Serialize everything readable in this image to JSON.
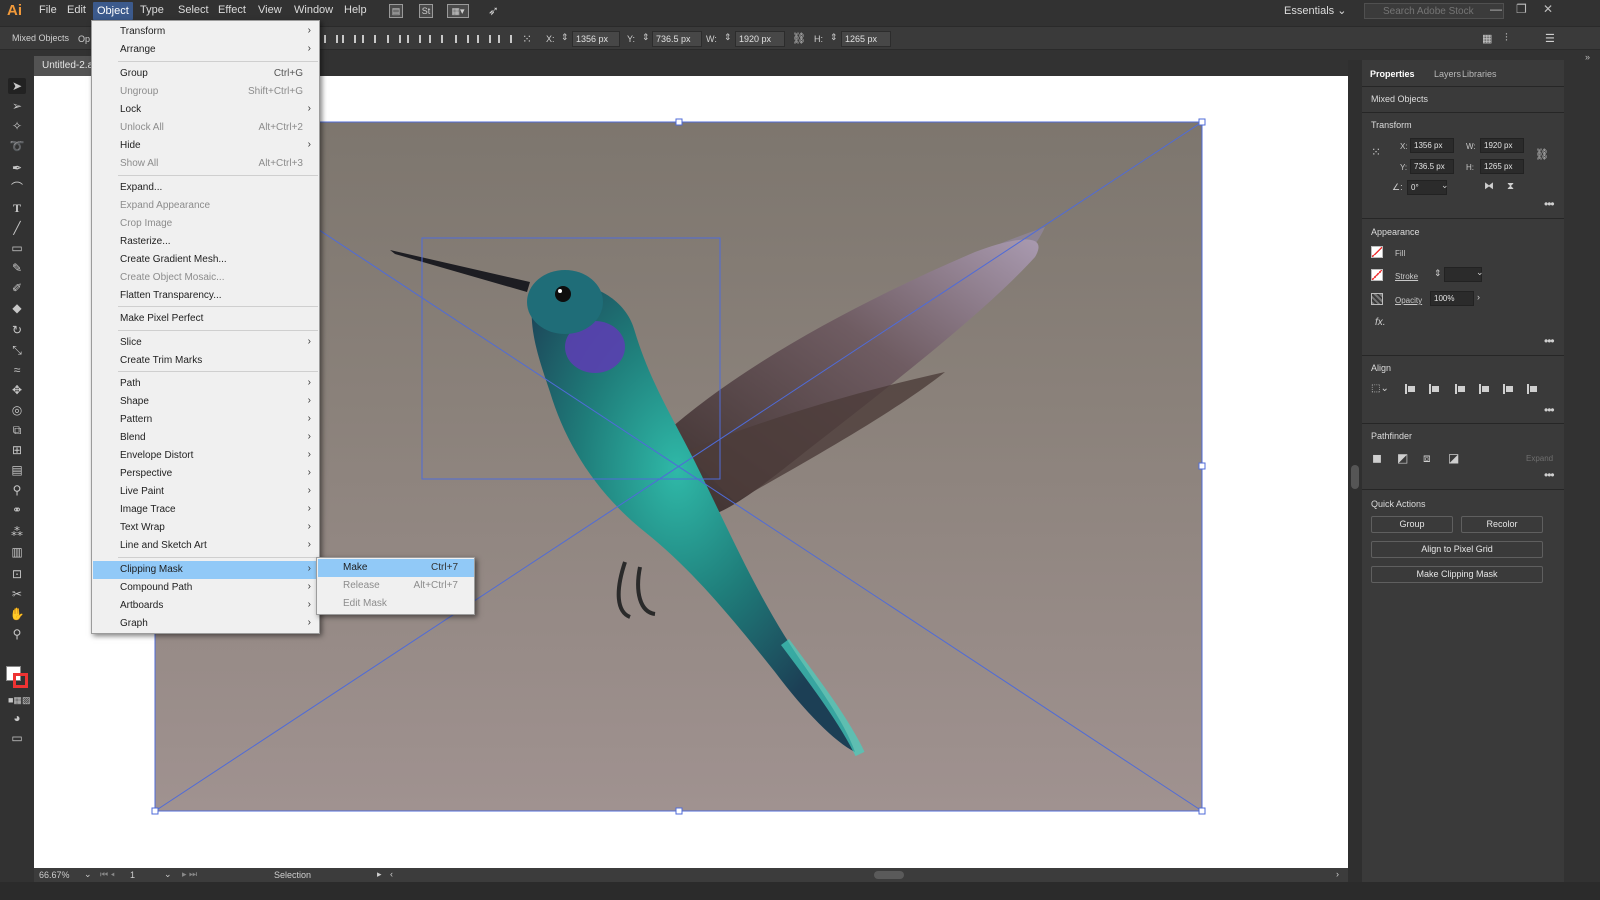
{
  "app": {
    "logo": "Ai"
  },
  "menubar": {
    "items": [
      "File",
      "Edit",
      "Object",
      "Type",
      "Select",
      "Effect",
      "View",
      "Window",
      "Help"
    ],
    "workspace": "Essentials",
    "search_placeholder": "Search Adobe Stock"
  },
  "controlbar": {
    "selection_label": "Mixed Objects",
    "opacity_label": "Op",
    "x_label": "X:",
    "x_value": "1356 px",
    "y_label": "Y:",
    "y_value": "736.5 px",
    "w_label": "W:",
    "w_value": "1920 px",
    "h_label": "H:",
    "h_value": "1265 px"
  },
  "document": {
    "tab_title": "Untitled-2.a"
  },
  "status": {
    "zoom": "66.67%",
    "page": "1",
    "tool": "Selection"
  },
  "object_menu": {
    "items": [
      {
        "label": "Transform",
        "shortcut": "",
        "submenu": true,
        "disabled": false
      },
      {
        "label": "Arrange",
        "shortcut": "",
        "submenu": true,
        "disabled": false
      },
      {
        "label": "Group",
        "shortcut": "Ctrl+G",
        "submenu": false,
        "disabled": false
      },
      {
        "label": "Ungroup",
        "shortcut": "Shift+Ctrl+G",
        "submenu": false,
        "disabled": true
      },
      {
        "label": "Lock",
        "shortcut": "",
        "submenu": true,
        "disabled": false
      },
      {
        "label": "Unlock All",
        "shortcut": "Alt+Ctrl+2",
        "submenu": false,
        "disabled": true
      },
      {
        "label": "Hide",
        "shortcut": "",
        "submenu": true,
        "disabled": false
      },
      {
        "label": "Show All",
        "shortcut": "Alt+Ctrl+3",
        "submenu": false,
        "disabled": true
      },
      {
        "label": "Expand...",
        "shortcut": "",
        "submenu": false,
        "disabled": false
      },
      {
        "label": "Expand Appearance",
        "shortcut": "",
        "submenu": false,
        "disabled": true
      },
      {
        "label": "Crop Image",
        "shortcut": "",
        "submenu": false,
        "disabled": true
      },
      {
        "label": "Rasterize...",
        "shortcut": "",
        "submenu": false,
        "disabled": false
      },
      {
        "label": "Create Gradient Mesh...",
        "shortcut": "",
        "submenu": false,
        "disabled": false
      },
      {
        "label": "Create Object Mosaic...",
        "shortcut": "",
        "submenu": false,
        "disabled": true
      },
      {
        "label": "Flatten Transparency...",
        "shortcut": "",
        "submenu": false,
        "disabled": false
      },
      {
        "label": "Make Pixel Perfect",
        "shortcut": "",
        "submenu": false,
        "disabled": false
      },
      {
        "label": "Slice",
        "shortcut": "",
        "submenu": true,
        "disabled": false
      },
      {
        "label": "Create Trim Marks",
        "shortcut": "",
        "submenu": false,
        "disabled": false
      },
      {
        "label": "Path",
        "shortcut": "",
        "submenu": true,
        "disabled": false
      },
      {
        "label": "Shape",
        "shortcut": "",
        "submenu": true,
        "disabled": false
      },
      {
        "label": "Pattern",
        "shortcut": "",
        "submenu": true,
        "disabled": false
      },
      {
        "label": "Blend",
        "shortcut": "",
        "submenu": true,
        "disabled": false
      },
      {
        "label": "Envelope Distort",
        "shortcut": "",
        "submenu": true,
        "disabled": false
      },
      {
        "label": "Perspective",
        "shortcut": "",
        "submenu": true,
        "disabled": false
      },
      {
        "label": "Live Paint",
        "shortcut": "",
        "submenu": true,
        "disabled": false
      },
      {
        "label": "Image Trace",
        "shortcut": "",
        "submenu": true,
        "disabled": false
      },
      {
        "label": "Text Wrap",
        "shortcut": "",
        "submenu": true,
        "disabled": false
      },
      {
        "label": "Line and Sketch Art",
        "shortcut": "",
        "submenu": true,
        "disabled": false
      },
      {
        "label": "Clipping Mask",
        "shortcut": "",
        "submenu": true,
        "disabled": false,
        "highlighted": true
      },
      {
        "label": "Compound Path",
        "shortcut": "",
        "submenu": true,
        "disabled": false
      },
      {
        "label": "Artboards",
        "shortcut": "",
        "submenu": true,
        "disabled": false
      },
      {
        "label": "Graph",
        "shortcut": "",
        "submenu": true,
        "disabled": false
      }
    ]
  },
  "clipping_submenu": {
    "items": [
      {
        "label": "Make",
        "shortcut": "Ctrl+7",
        "disabled": false,
        "highlighted": true
      },
      {
        "label": "Release",
        "shortcut": "Alt+Ctrl+7",
        "disabled": true
      },
      {
        "label": "Edit Mask",
        "shortcut": "",
        "disabled": true
      }
    ]
  },
  "properties_panel": {
    "tabs": [
      "Properties",
      "Layers",
      "Libraries"
    ],
    "selection_type": "Mixed Objects",
    "transform": {
      "title": "Transform",
      "x_label": "X:",
      "x": "1356 px",
      "y_label": "Y:",
      "y": "736.5 px",
      "w_label": "W:",
      "w": "1920 px",
      "h_label": "H:",
      "h": "1265 px",
      "angle": "0°"
    },
    "appearance": {
      "title": "Appearance",
      "fill_label": "Fill",
      "stroke_label": "Stroke",
      "opacity_label": "Opacity",
      "opacity": "100%",
      "fx_label": "fx."
    },
    "align": {
      "title": "Align"
    },
    "pathfinder": {
      "title": "Pathfinder",
      "expand_label": "Expand"
    },
    "quick_actions": {
      "title": "Quick Actions",
      "group": "Group",
      "recolor": "Recolor",
      "align_pixel": "Align to Pixel Grid",
      "make_clipping": "Make Clipping Mask"
    }
  },
  "colors": {
    "selection_blue": "#4f6bd8",
    "menu_highlight": "#91c9f7",
    "ui_dark": "#323232",
    "brand_orange": "#f29a3a"
  }
}
